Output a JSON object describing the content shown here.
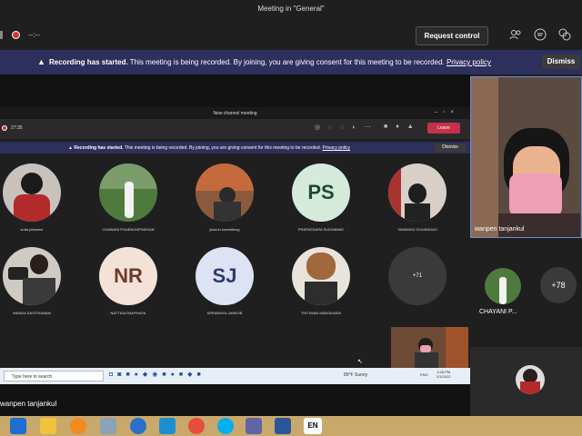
{
  "window": {
    "title": "Meeting in \"General\""
  },
  "toolbar": {
    "timer": "--:--",
    "request_control": "Request control"
  },
  "banner": {
    "bold": "Recording has started.",
    "text": " This meeting is being recorded. By joining, you are giving consent for this meeting to be recorded.",
    "link": "Privacy policy",
    "dismiss": "Dismiss"
  },
  "shared": {
    "title": "New channel meeting",
    "timer": "27:35",
    "leave": "Leave",
    "banner_bold": "Recording has started.",
    "banner_text": " This meeting is being recorded. By joining, you are giving consent for this meeting to be recorded.",
    "banner_link": "Privacy policy",
    "banner_dismiss": "Dismiss",
    "participants_row1": [
      "suda jeksaree",
      "CHAWANI PHUENUNPHAISAN",
      "jaturon kumatitong",
      "PRAPASSARA SUDSAMAD",
      "TANAWAD DOUANGAO"
    ],
    "participants_row2": [
      "WANDA SASITHANAM",
      "NATTIDA RAKPHAYA",
      "SIRIWANYA JANKOB",
      "THITIWAN MANGKAEW"
    ],
    "initials": {
      "ps": "PS",
      "nr": "NR",
      "sj": "SJ"
    },
    "more_count": "+71",
    "search_placeholder": "Type here to search",
    "weather": "89°F  Sunny",
    "time": "3:28 PM",
    "date": "2/1/2022",
    "lang": "ENG"
  },
  "right_panel": {
    "self_name": "wanpen tanjankul",
    "participant": "CHAYANI P...",
    "more_count": "+78"
  },
  "bottom": {
    "presenter": "wanpen tanjankul",
    "lang": "EN"
  }
}
